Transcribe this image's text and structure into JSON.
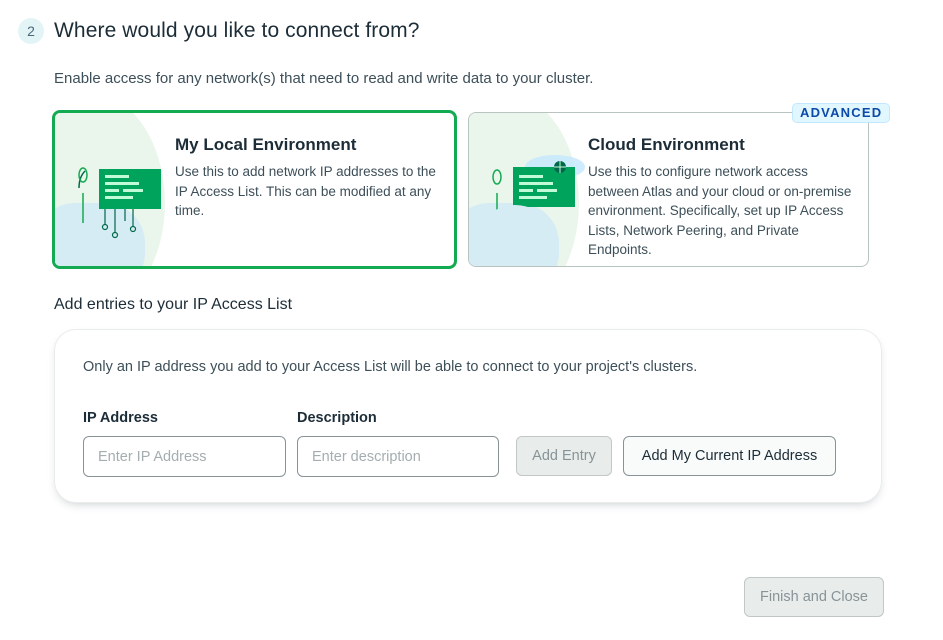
{
  "step": {
    "number": "2",
    "title": "Where would you like to connect from?"
  },
  "intro_text": "Enable access for any network(s) that need to read and write data to your cluster.",
  "environments": {
    "local": {
      "title": "My Local Environment",
      "description": "Use this to add network IP addresses to the IP Access List. This can be modified at any time.",
      "selected": true
    },
    "cloud": {
      "title": "Cloud Environment",
      "badge": "ADVANCED",
      "description": "Use this to configure network access between Atlas and your cloud or on-premise environment. Specifically, set up IP Access Lists, Network Peering, and Private Endpoints.",
      "selected": false
    }
  },
  "access_list": {
    "section_title": "Add entries to your IP Access List",
    "note": "Only an IP address you add to your Access List will be able to connect to your project's clusters.",
    "ip_label": "IP Address",
    "ip_placeholder": "Enter IP Address",
    "ip_value": "",
    "desc_label": "Description",
    "desc_placeholder": "Enter description",
    "desc_value": "",
    "add_entry_label": "Add Entry",
    "add_my_ip_label": "Add My Current IP Address"
  },
  "footer": {
    "finish_label": "Finish and Close"
  },
  "colors": {
    "brand_green": "#13aa52",
    "badge_blue": "#0c4aa7",
    "disabled_bg": "#e8edeb"
  }
}
